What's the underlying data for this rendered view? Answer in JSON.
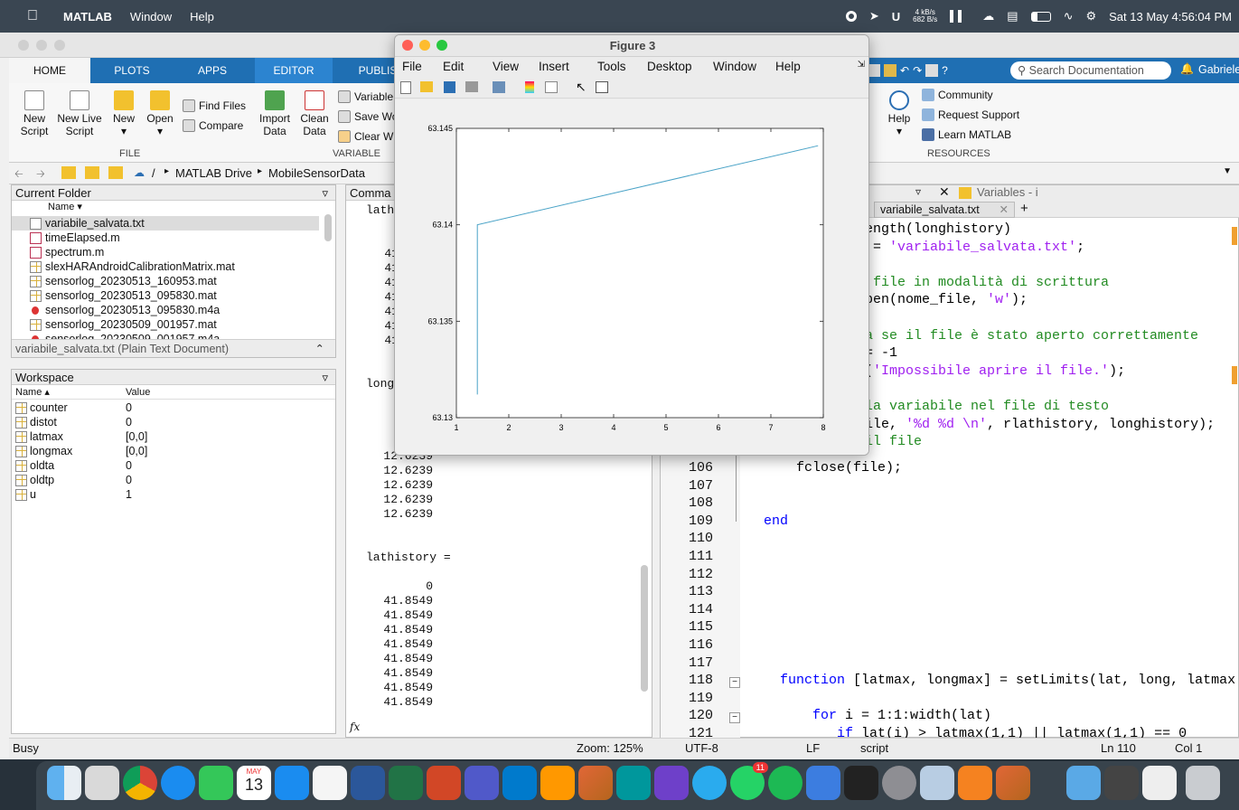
{
  "menubar": {
    "app": "MATLAB",
    "items": [
      "Window",
      "Help"
    ],
    "u_badge": "U",
    "net_up": "4 kB/s",
    "net_down": "682 B/s",
    "datetime": "Sat 13 May  4:56:04 PM"
  },
  "tabs": [
    "HOME",
    "PLOTS",
    "APPS",
    "EDITOR",
    "PUBLIS"
  ],
  "ribbon": {
    "new_script": "New Script",
    "new_live": "New Live Script",
    "new": "New",
    "open": "Open",
    "find_files": "Find Files",
    "compare": "Compare",
    "import": "Import Data",
    "clean": "Clean Data",
    "variable": "Variable",
    "save_wo": "Save Wo",
    "clear_w": "Clear W",
    "file_section": "FILE",
    "variable_section": "VARIABLE",
    "resources_section": "RESOURCES",
    "help": "Help",
    "community": "Community",
    "request_support": "Request Support",
    "learn": "Learn MATLAB",
    "search_placeholder": "Search Documentation",
    "user": "Gabriele"
  },
  "address": {
    "root": "/",
    "path1": "MATLAB Drive",
    "path2": "MobileSensorData"
  },
  "current_folder": {
    "title": "Current Folder",
    "name_col": "Name",
    "files": [
      {
        "name": "variabile_salvata.txt",
        "type": "txt"
      },
      {
        "name": "timeElapsed.m",
        "type": "m"
      },
      {
        "name": "spectrum.m",
        "type": "m"
      },
      {
        "name": "slexHARAndroidCalibrationMatrix.mat",
        "type": "mat"
      },
      {
        "name": "sensorlog_20230513_160953.mat",
        "type": "mat"
      },
      {
        "name": "sensorlog_20230513_095830.mat",
        "type": "mat"
      },
      {
        "name": "sensorlog_20230513_095830.m4a",
        "type": "m4a"
      },
      {
        "name": "sensorlog_20230509_001957.mat",
        "type": "mat"
      },
      {
        "name": "sensorlog_20230509_001957.m4a",
        "type": "m4a"
      }
    ],
    "details": "variabile_salvata.txt  (Plain Text Document)"
  },
  "workspace": {
    "title": "Workspace",
    "name_col": "Name",
    "value_col": "Value",
    "vars": [
      {
        "name": "counter",
        "value": "0"
      },
      {
        "name": "distot",
        "value": "0"
      },
      {
        "name": "latmax",
        "value": "[0,0]"
      },
      {
        "name": "longmax",
        "value": "[0,0]"
      },
      {
        "name": "oldta",
        "value": "0"
      },
      {
        "name": "oldtp",
        "value": "0"
      },
      {
        "name": "u",
        "value": "1"
      }
    ]
  },
  "command": {
    "title": "Comma",
    "lath": "lath",
    "top_values": [
      "41",
      "41",
      "41",
      "41",
      "41",
      "41",
      "41"
    ],
    "longh": "longh",
    "mid_values": [
      "12",
      "12",
      "12.6239",
      "12.6239",
      "12.6239",
      "12.6239",
      "12.6239"
    ],
    "lathistory": "lathistory =",
    "lathistory_values": [
      "0",
      "41.8549",
      "41.8549",
      "41.8549",
      "41.8549",
      "41.8549",
      "41.8549",
      "41.8549",
      "41.8549"
    ],
    "fx": "fx"
  },
  "editor": {
    "tab_file": "variabile_salvata.txt",
    "tab_plus": "+",
    "variables_title": "Variables - i",
    "upper_lines": [
      {
        "segments": [
          {
            "t": "ength(longhistory)",
            "c": "#000"
          }
        ]
      },
      {
        "segments": [
          {
            "t": " = ",
            "c": "#000"
          },
          {
            "t": "'variabile_salvata.txt'",
            "c": "#a020f0"
          },
          {
            "t": ";",
            "c": "#000"
          }
        ]
      },
      {
        "segments": []
      },
      {
        "segments": [
          {
            "t": " file in modalità di scrittura",
            "c": "#228b22"
          }
        ]
      },
      {
        "segments": [
          {
            "t": "pen(nome_file, ",
            "c": "#000"
          },
          {
            "t": "'w'",
            "c": "#a020f0"
          },
          {
            "t": ");",
            "c": "#000"
          }
        ]
      },
      {
        "segments": []
      },
      {
        "segments": [
          {
            "t": "a se il file è stato aperto correttamente",
            "c": "#228b22"
          }
        ]
      },
      {
        "segments": [
          {
            "t": "= -1",
            "c": "#000"
          }
        ]
      },
      {
        "segments": [
          {
            "t": "(",
            "c": "#000"
          },
          {
            "t": "'Impossibile aprire il file.'",
            "c": "#a020f0"
          },
          {
            "t": ");",
            "c": "#000"
          }
        ]
      },
      {
        "segments": []
      },
      {
        "segments": [
          {
            "t": "la variabile nel file di testo",
            "c": "#228b22"
          }
        ]
      },
      {
        "segments": [
          {
            "t": "ile, ",
            "c": "#000"
          },
          {
            "t": "'%d %d \\n'",
            "c": "#a020f0"
          },
          {
            "t": ", rlathistory, longhistory);",
            "c": "#000"
          }
        ]
      },
      {
        "segments": [
          {
            "t": "il file",
            "c": "#228b22"
          }
        ]
      }
    ],
    "numbered_lines": [
      {
        "n": "106",
        "segments": [
          {
            "t": "    fclose(file);",
            "c": "#000"
          }
        ]
      },
      {
        "n": "107",
        "segments": []
      },
      {
        "n": "108",
        "segments": []
      },
      {
        "n": "109",
        "segments": [
          {
            "t": "end",
            "c": "#0000ff"
          }
        ]
      },
      {
        "n": "110",
        "segments": []
      },
      {
        "n": "111",
        "segments": []
      },
      {
        "n": "112",
        "segments": []
      },
      {
        "n": "113",
        "segments": []
      },
      {
        "n": "114",
        "segments": []
      },
      {
        "n": "115",
        "segments": []
      },
      {
        "n": "116",
        "segments": []
      },
      {
        "n": "117",
        "segments": []
      },
      {
        "n": "118",
        "segments": [
          {
            "t": "  function",
            "c": "#0000ff"
          },
          {
            "t": " [latmax, longmax] = setLimits(lat, long, latmax",
            "c": "#000"
          }
        ]
      },
      {
        "n": "119",
        "segments": []
      },
      {
        "n": "120",
        "segments": [
          {
            "t": "      for",
            "c": "#0000ff"
          },
          {
            "t": " i = 1:1:width(lat)",
            "c": "#000"
          }
        ]
      },
      {
        "n": "121",
        "segments": [
          {
            "t": "         if",
            "c": "#0000ff"
          },
          {
            "t": " lat(i) > latmax(1,1) || latmax(1,1) == 0",
            "c": "#000"
          }
        ]
      }
    ]
  },
  "status": {
    "busy": "Busy",
    "zoom": "Zoom: 125%",
    "encoding": "UTF-8",
    "eol": "LF",
    "type": "script",
    "ln": "Ln  110",
    "col": "Col  1"
  },
  "figure": {
    "title": "Figure 3",
    "menu": [
      "File",
      "Edit",
      "View",
      "Insert",
      "Tools",
      "Desktop",
      "Window",
      "Help"
    ]
  },
  "chart_data": {
    "type": "line",
    "x": [
      1.4,
      1.4,
      7.9
    ],
    "y": [
      63.1312,
      63.14,
      63.1441
    ],
    "xlim": [
      1,
      8
    ],
    "ylim": [
      63.13,
      63.145
    ],
    "xticks": [
      "1",
      "2",
      "3",
      "4",
      "5",
      "6",
      "7",
      "8"
    ],
    "yticks": [
      "63.13",
      "63.135",
      "63.14",
      "63.145"
    ],
    "line_color": "#4aa3c7",
    "grid": false
  },
  "dock": {
    "calendar_month": "MAY",
    "calendar_day": "13",
    "whatsapp_badge": "11"
  }
}
